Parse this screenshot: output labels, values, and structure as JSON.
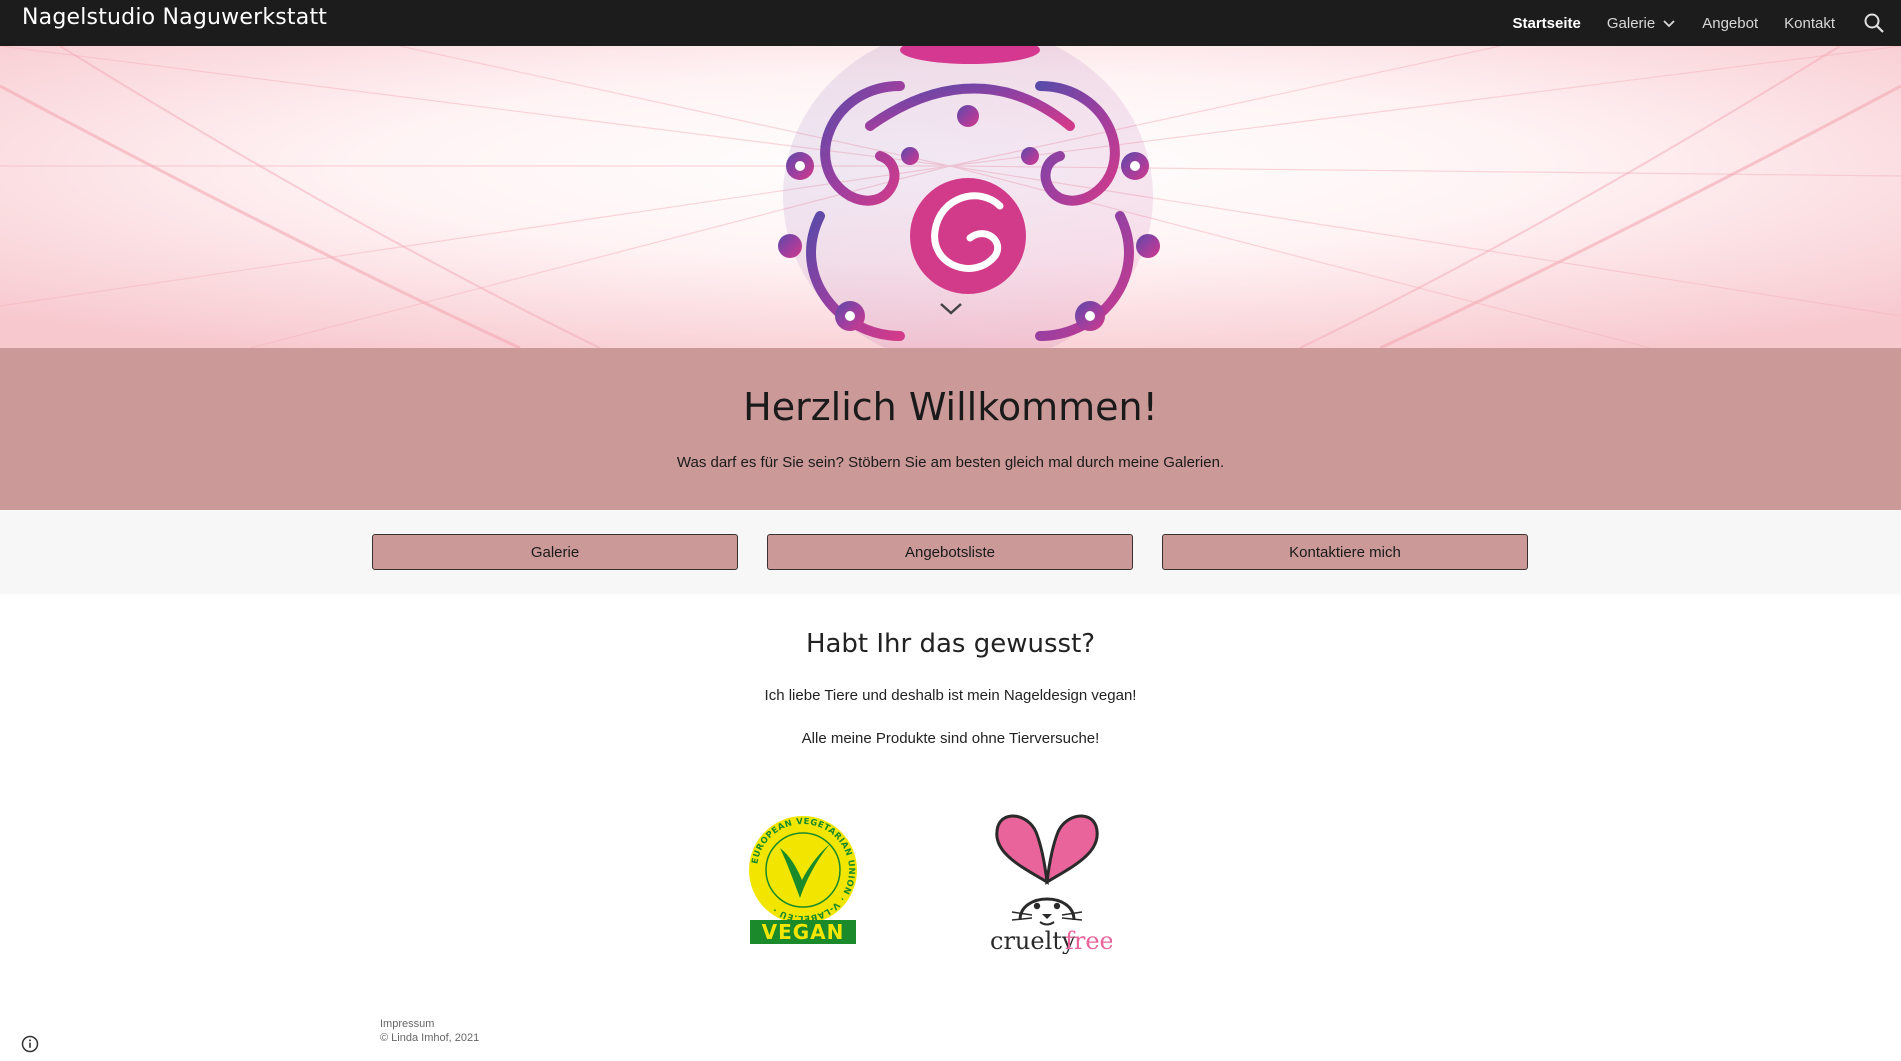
{
  "header": {
    "site_title": "Nagelstudio Naguwerkstatt",
    "nav": [
      {
        "label": "Startseite",
        "active": true
      },
      {
        "label": "Galerie",
        "has_dropdown": true
      },
      {
        "label": "Angebot"
      },
      {
        "label": "Kontakt"
      }
    ],
    "search_icon": "search-icon"
  },
  "welcome": {
    "title": "Herzlich Willkommen!",
    "text": "Was darf es für Sie sein? Stöbern Sie am besten gleich mal durch meine Galerien."
  },
  "buttons": [
    {
      "label": "Galerie"
    },
    {
      "label": "Angebotsliste"
    },
    {
      "label": "Kontaktiere mich"
    }
  ],
  "info": {
    "title": "Habt Ihr das gewusst?",
    "line1": "Ich liebe Tiere und deshalb ist mein Nageldesign vegan!",
    "line2": "Alle meine Produkte sind ohne Tierversuche!"
  },
  "logos": {
    "vegan_ring_text": "EUROPEAN VEGETARIAN UNION · V-LABEL.EU ·",
    "vegan_label": "VEGAN",
    "cruelty_word1": "cruelty",
    "cruelty_word2": "free"
  },
  "footer": {
    "impressum": "Impressum",
    "copyright": "© Linda Imhof, 2021"
  },
  "colors": {
    "topbar": "#1c1c1c",
    "accent": "#cc9999",
    "button_band": "#f7f7f7",
    "vegan_yellow": "#f2e600",
    "vegan_green": "#1a8a2a",
    "cruelty_pink": "#e8649a"
  }
}
